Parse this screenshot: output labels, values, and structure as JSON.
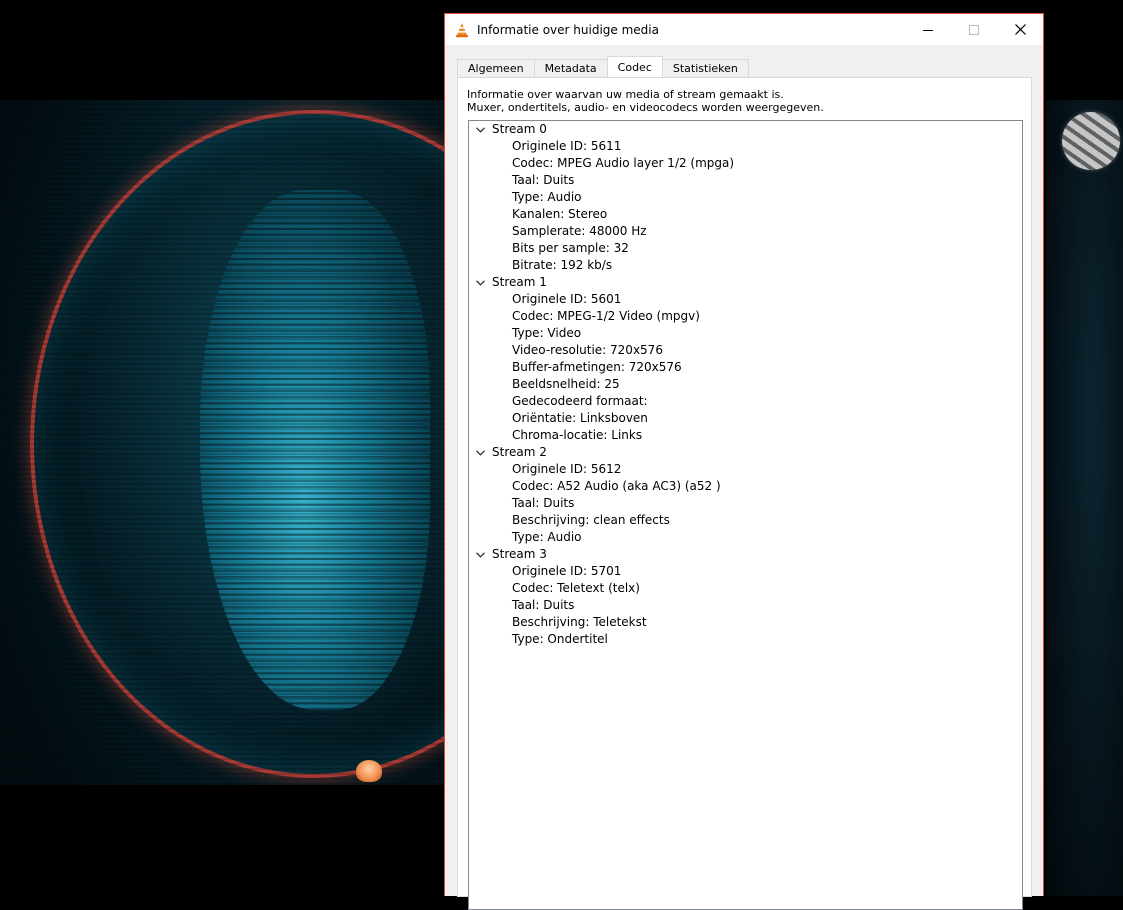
{
  "window": {
    "title": "Informatie over huidige media",
    "controls": {
      "minimize": "—",
      "maximize": "☐",
      "close": "✕"
    }
  },
  "tabs": [
    {
      "label": "Algemeen",
      "active": false
    },
    {
      "label": "Metadata",
      "active": false
    },
    {
      "label": "Codec",
      "active": true
    },
    {
      "label": "Statistieken",
      "active": false
    }
  ],
  "codec": {
    "description_line1": "Informatie over waarvan uw media of stream gemaakt is.",
    "description_line2": "Muxer, ondertitels, audio- en videocodecs worden weergegeven.",
    "streams": [
      {
        "label": "Stream 0",
        "items": [
          "Originele ID: 5611",
          "Codec: MPEG Audio layer 1/2 (mpga)",
          "Taal: Duits",
          "Type: Audio",
          "Kanalen: Stereo",
          "Samplerate: 48000 Hz",
          "Bits per sample: 32",
          "Bitrate: 192 kb/s"
        ]
      },
      {
        "label": "Stream 1",
        "items": [
          "Originele ID: 5601",
          "Codec: MPEG-1/2 Video (mpgv)",
          "Type: Video",
          "Video-resolutie: 720x576",
          "Buffer-afmetingen: 720x576",
          "Beeldsnelheid: 25",
          "Gedecodeerd formaat:",
          "Oriëntatie: Linksboven",
          "Chroma-locatie: Links"
        ]
      },
      {
        "label": "Stream 2",
        "items": [
          "Originele ID: 5612",
          "Codec: A52 Audio (aka AC3) (a52 )",
          "Taal: Duits",
          "Beschrijving: clean effects",
          "Type: Audio"
        ]
      },
      {
        "label": "Stream 3",
        "items": [
          "Originele ID: 5701",
          "Codec: Teletext (telx)",
          "Taal: Duits",
          "Beschrijving: Teletekst",
          "Type: Ondertitel"
        ]
      }
    ]
  },
  "icons": {
    "app": "vlc-cone-icon",
    "expand": "chevron-down-icon"
  },
  "colors": {
    "window_border": "#e04a3a",
    "vlc_orange": "#f08a24"
  }
}
